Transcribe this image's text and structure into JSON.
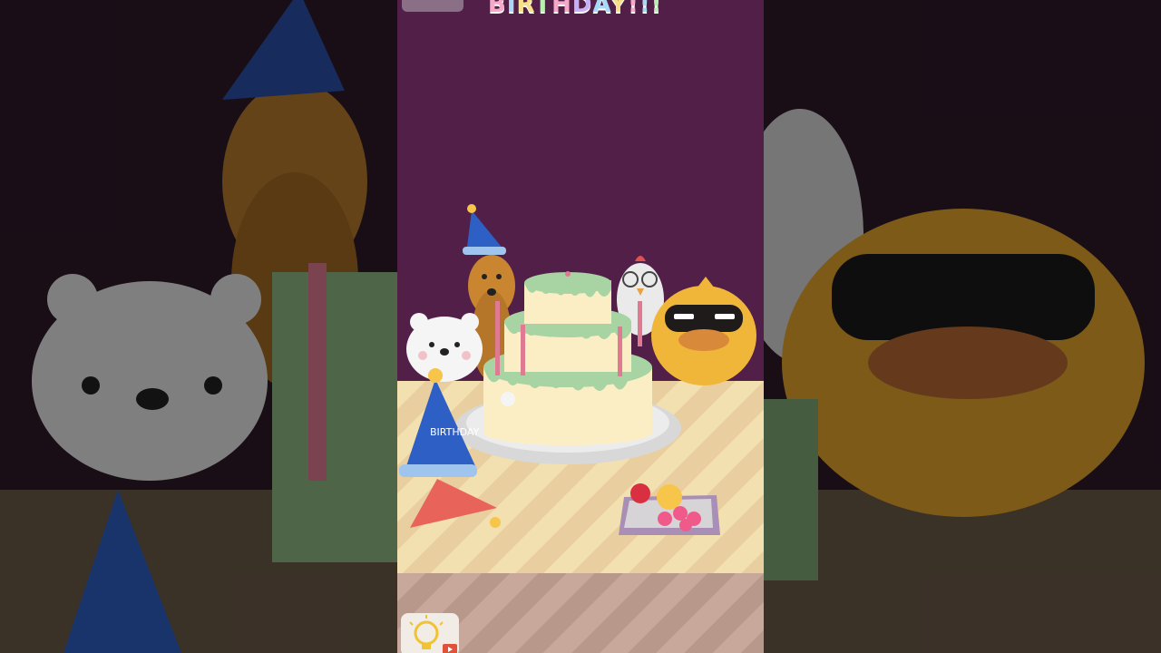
{
  "game": {
    "title": "BIRTHDAY!!!",
    "title_colors": [
      "#f6a8c8",
      "#a8d8f6",
      "#f6e08a",
      "#b8f0b0",
      "#f6a8c8",
      "#c8b0f6",
      "#a8d8f6",
      "#f6e08a",
      "#f6a8c8",
      "#a8d8f6",
      "#b8f0b0"
    ],
    "party_hat_text": "HAPPY BIRTHDAY"
  },
  "ui": {
    "menu_icon": "menu-icon",
    "hint_icon": "lightbulb-icon",
    "video_icon": "play-video-icon"
  },
  "colors": {
    "wall": "#511f47",
    "cake_frosting": "#a8d4a4",
    "cake_cream": "#fbeec4",
    "hat_blue": "#2d5fc4"
  }
}
